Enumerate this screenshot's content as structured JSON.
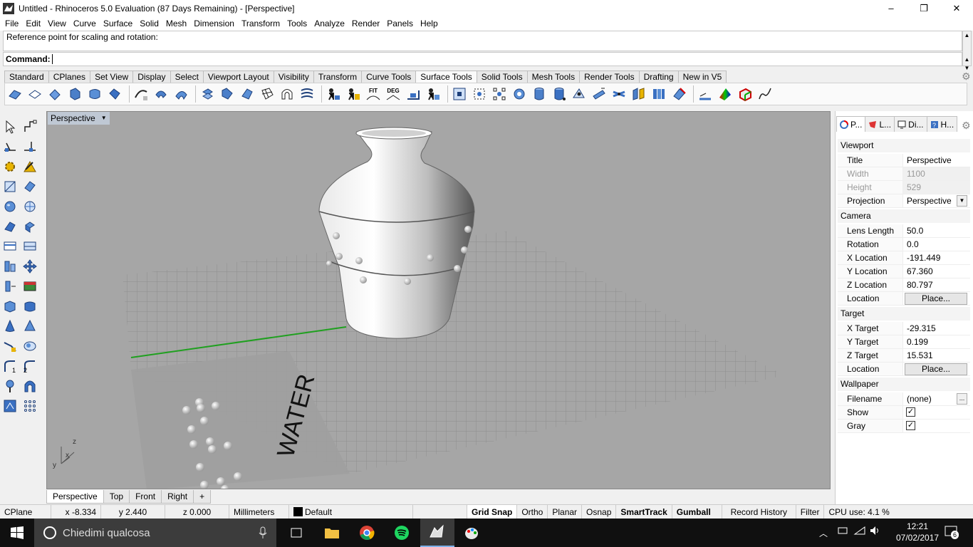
{
  "window": {
    "title": "Untitled - Rhinoceros 5.0 Evaluation (87 Days Remaining) - [Perspective]",
    "minimize": "–",
    "maximize": "❐",
    "close": "✕"
  },
  "menu": [
    "File",
    "Edit",
    "View",
    "Curve",
    "Surface",
    "Solid",
    "Mesh",
    "Dimension",
    "Transform",
    "Tools",
    "Analyze",
    "Render",
    "Panels",
    "Help"
  ],
  "command": {
    "history": "Reference point for scaling and rotation:",
    "prompt": "Command:",
    "value": ""
  },
  "toolbar_tabs": [
    "Standard",
    "CPlanes",
    "Set View",
    "Display",
    "Select",
    "Viewport Layout",
    "Visibility",
    "Transform",
    "Curve Tools",
    "Surface Tools",
    "Solid Tools",
    "Mesh Tools",
    "Render Tools",
    "Drafting",
    "New in V5"
  ],
  "toolbar_active_tab": "Surface Tools",
  "toolbar_icons": {
    "fit": "FIT",
    "deg": "DEG"
  },
  "viewport": {
    "title": "Perspective",
    "tabs": [
      "Perspective",
      "Top",
      "Front",
      "Right"
    ],
    "active_tab": "Perspective",
    "add_tab": "+",
    "scene_text": "WATER",
    "axis": {
      "x": "x",
      "y": "y",
      "z": "z"
    }
  },
  "panel": {
    "tabs": [
      "P...",
      "L...",
      "Di...",
      "H..."
    ],
    "viewport_section": "Viewport",
    "title_label": "Title",
    "title_value": "Perspective",
    "width_label": "Width",
    "width_value": "1100",
    "height_label": "Height",
    "height_value": "529",
    "projection_label": "Projection",
    "projection_value": "Perspective",
    "camera_section": "Camera",
    "lens_label": "Lens Length",
    "lens_value": "50.0",
    "rotation_label": "Rotation",
    "rotation_value": "0.0",
    "xloc_label": "X Location",
    "xloc_value": "-191.449",
    "yloc_label": "Y Location",
    "yloc_value": "67.360",
    "zloc_label": "Z Location",
    "zloc_value": "80.797",
    "loc_label": "Location",
    "place_button": "Place...",
    "target_section": "Target",
    "xt_label": "X Target",
    "xt_value": "-29.315",
    "yt_label": "Y Target",
    "yt_value": "0.199",
    "zt_label": "Z Target",
    "zt_value": "15.531",
    "tloc_label": "Location",
    "tplace_button": "Place...",
    "wallpaper_section": "Wallpaper",
    "filename_label": "Filename",
    "filename_value": "(none)",
    "browse": "...",
    "show_label": "Show",
    "show_checked": true,
    "gray_label": "Gray",
    "gray_checked": true
  },
  "status": {
    "cplane": "CPlane",
    "x": "x -8.334",
    "y": "y 2.440",
    "z": "z 0.000",
    "units": "Millimeters",
    "layer": "Default",
    "grid_snap": "Grid Snap",
    "ortho": "Ortho",
    "planar": "Planar",
    "osnap": "Osnap",
    "smarttrack": "SmartTrack",
    "gumball": "Gumball",
    "record_history": "Record History",
    "filter": "Filter",
    "cpu": "CPU use: 4.1 %"
  },
  "taskbar": {
    "search_placeholder": "Chiedimi qualcosa",
    "time": "12:21",
    "date": "07/02/2017",
    "notifications": "6"
  }
}
